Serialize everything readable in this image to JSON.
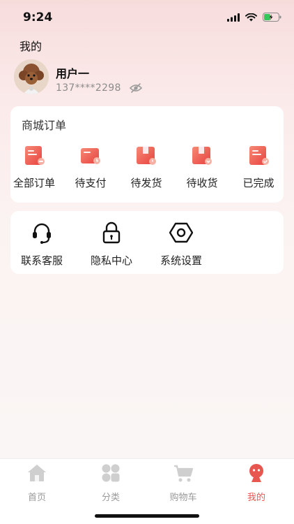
{
  "status_bar": {
    "time": "9:24"
  },
  "colors": {
    "accent": "#e8574f",
    "icon_gradient_start": "#f58a76",
    "icon_gradient_end": "#e9423f",
    "tab_inactive": "#9a9a9a"
  },
  "header": {
    "title": "我的"
  },
  "user": {
    "name": "用户一",
    "phone": "137****2298"
  },
  "orders": {
    "title": "商城订单",
    "items": [
      {
        "label": "全部订单",
        "icon": "document-icon"
      },
      {
        "label": "待支付",
        "icon": "wallet-icon"
      },
      {
        "label": "待发货",
        "icon": "box-icon"
      },
      {
        "label": "待收货",
        "icon": "package-receive-icon"
      },
      {
        "label": "已完成",
        "icon": "document-check-icon"
      }
    ]
  },
  "services": {
    "items": [
      {
        "label": "联系客服",
        "icon": "headset-icon"
      },
      {
        "label": "隐私中心",
        "icon": "lock-icon"
      },
      {
        "label": "系统设置",
        "icon": "settings-hexagon-icon"
      }
    ]
  },
  "tabs": [
    {
      "label": "首页",
      "icon": "home-icon",
      "active": false
    },
    {
      "label": "分类",
      "icon": "category-grid-icon",
      "active": false
    },
    {
      "label": "购物车",
      "icon": "cart-icon",
      "active": false
    },
    {
      "label": "我的",
      "icon": "profile-icon",
      "active": true
    }
  ]
}
